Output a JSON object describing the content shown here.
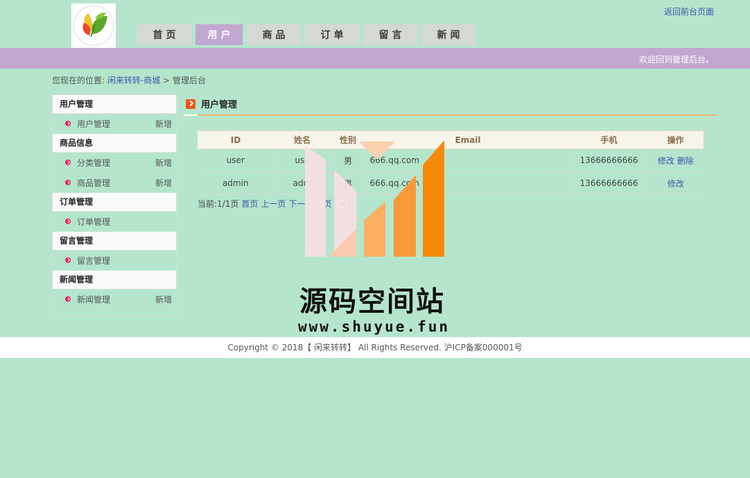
{
  "header": {
    "logo": "leaf-logo",
    "back_link": "返回前台页面",
    "nav": [
      {
        "label": "首页",
        "active": false
      },
      {
        "label": "用户",
        "active": true
      },
      {
        "label": "商品",
        "active": false
      },
      {
        "label": "订单",
        "active": false
      },
      {
        "label": "留言",
        "active": false
      },
      {
        "label": "新闻",
        "active": false
      }
    ],
    "welcome": "欢迎回到管理后台。"
  },
  "breadcrumb": {
    "prefix": "您现在的位置:",
    "link": "闲来转转-商城",
    "sep": ">",
    "current": "管理后台"
  },
  "sidebar": {
    "groups": [
      {
        "title": "用户管理",
        "items": [
          {
            "label": "用户管理",
            "add": "新增"
          }
        ]
      },
      {
        "title": "商品信息",
        "items": [
          {
            "label": "分类管理",
            "add": "新增"
          },
          {
            "label": "商品管理",
            "add": "新增"
          }
        ]
      },
      {
        "title": "订单管理",
        "items": [
          {
            "label": "订单管理",
            "add": ""
          }
        ]
      },
      {
        "title": "留言管理",
        "items": [
          {
            "label": "留言管理",
            "add": ""
          }
        ]
      },
      {
        "title": "新闻管理",
        "items": [
          {
            "label": "新闻管理",
            "add": "新增"
          }
        ]
      }
    ]
  },
  "main": {
    "title": "用户管理",
    "table": {
      "headers": [
        "ID",
        "姓名",
        "性别",
        "Email",
        "手机",
        "操作"
      ],
      "rows": [
        {
          "id": "user",
          "name": "use",
          "gender": "男",
          "email": "666.qq.com",
          "phone": "13666666666",
          "edit": "修改",
          "delete": "删除"
        },
        {
          "id": "admin",
          "name": "adm",
          "gender": "男",
          "email": "666.qq.com",
          "phone": "13666666666",
          "edit": "修改",
          "delete": ""
        }
      ]
    },
    "pager": {
      "current": "当前:1/1页",
      "first": "首页",
      "prev": "上一页",
      "next": "下一",
      "last": "页"
    }
  },
  "footer": {
    "text": "Copyright © 2018【 闲来转转】 All Rights Reserved. 沪ICP备案000001号"
  },
  "watermark": {
    "title": "源码空间站",
    "url": "www.shuyue.fun"
  },
  "colors": {
    "background": "#b5e6cd",
    "accent_bar": "#c1a7d1",
    "link": "#3b56a8",
    "title_underline": "#f0b76a"
  }
}
